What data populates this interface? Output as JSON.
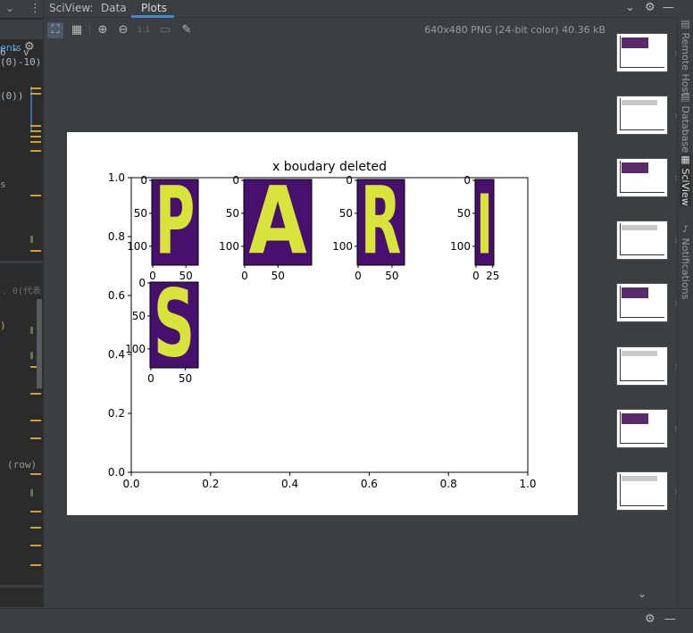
{
  "tool_window": {
    "title": "SciView:",
    "tabs": [
      {
        "label": "Data",
        "active": false
      },
      {
        "label": "Plots",
        "active": true
      }
    ]
  },
  "editor_fragments": {
    "line1": "6",
    "line2": "(0)-10)",
    "line3": "(0))",
    "line4": "s",
    "ents_label": "ents",
    "comment": ". 0(代表",
    "line5": ")",
    "line6": "(row)"
  },
  "toolbar": {
    "icons": [
      "fit-screen-icon",
      "grid-icon",
      "zoom-in-icon",
      "zoom-out-icon",
      "actual-size-icon",
      "background-icon",
      "color-picker-icon"
    ],
    "actual_size_label": "1:1",
    "image_info": "640x480 PNG (24-bit color) 40.36 kB"
  },
  "plot": {
    "title": "x boudary deleted",
    "axis_color": "#000000",
    "letter_fill": "#d8e43a",
    "letter_bg": "#47106e"
  },
  "chart_data": {
    "type": "scatter",
    "title": "x boudary deleted",
    "xlim": [
      0.0,
      1.0
    ],
    "ylim": [
      0.0,
      1.0
    ],
    "xticks": [
      "0.0",
      "0.2",
      "0.4",
      "0.6",
      "0.8",
      "1.0"
    ],
    "yticks": [
      "0.0",
      "0.2",
      "0.4",
      "0.6",
      "0.8",
      "1.0"
    ],
    "insets": [
      {
        "letter": "P",
        "xticks": [
          "0",
          "50"
        ],
        "yticks": [
          "0",
          "50",
          "100"
        ]
      },
      {
        "letter": "A",
        "xticks": [
          "0",
          "50"
        ],
        "yticks": [
          "0",
          "50",
          "100"
        ]
      },
      {
        "letter": "R",
        "xticks": [
          "0",
          "50"
        ],
        "yticks": [
          "0",
          "50",
          "100"
        ]
      },
      {
        "letter": "I",
        "xticks": [
          "0",
          "25"
        ],
        "yticks": [
          "0",
          "50",
          "100"
        ]
      },
      {
        "letter": "S",
        "xticks": [
          "0",
          "50"
        ],
        "yticks": [
          "0",
          "50",
          "100"
        ]
      }
    ]
  },
  "side_tabs": [
    {
      "label": "Remote Host",
      "active": false
    },
    {
      "label": "Database",
      "active": false
    },
    {
      "label": "SciView",
      "active": true
    },
    {
      "label": "Notifications",
      "active": false
    }
  ],
  "thumbnails": [
    {
      "name": "thumb-1"
    },
    {
      "name": "thumb-2"
    },
    {
      "name": "thumb-3"
    },
    {
      "name": "thumb-4"
    },
    {
      "name": "thumb-5"
    },
    {
      "name": "thumb-6"
    },
    {
      "name": "thumb-7"
    },
    {
      "name": "thumb-8"
    }
  ]
}
